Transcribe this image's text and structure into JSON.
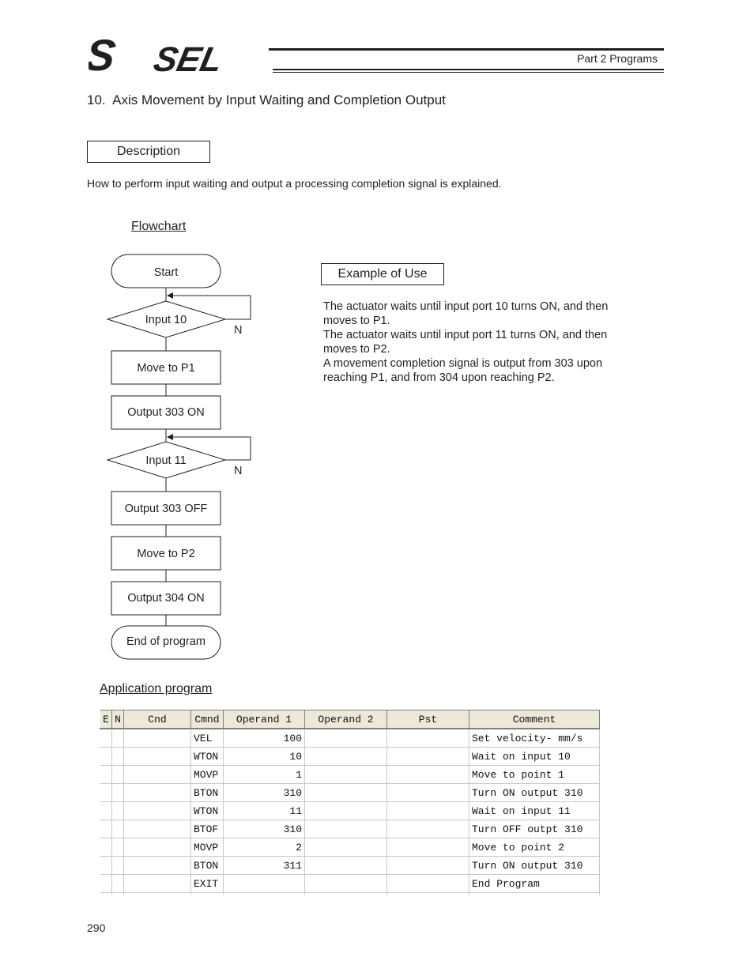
{
  "header": {
    "logo_text": "S SEL",
    "part_label": "Part 2 Programs"
  },
  "section_title": "10.  Axis Movement by Input Waiting and Completion Output",
  "description": {
    "box_label": "Description",
    "text": "How to perform input waiting and output a processing completion signal is explained."
  },
  "flowchart": {
    "label": "Flowchart",
    "nodes": {
      "start": "Start",
      "input10": "Input 10",
      "move_p1": "Move to P1",
      "out303_on": "Output 303 ON",
      "input11": "Input 11",
      "out303_off": "Output 303 OFF",
      "move_p2": "Move to P2",
      "out304_on": "Output 304 ON",
      "end": "End of program"
    },
    "no_branch_label": "N"
  },
  "example": {
    "box_label": "Example of Use",
    "lines": [
      "The actuator waits until input port 10 turns ON, and then",
      "moves to P1.",
      "The actuator waits until input port 11 turns ON, and then",
      "moves to P2.",
      "A movement completion signal is output from 303 upon",
      "reaching P1, and from 304 upon reaching P2."
    ]
  },
  "application_program": {
    "label": "Application program",
    "columns": [
      "E",
      "N",
      "Cnd",
      "Cmnd",
      "Operand 1",
      "Operand 2",
      "Pst",
      "Comment"
    ],
    "rows": [
      {
        "e": "",
        "n": "",
        "cnd": "",
        "cmnd": "VEL",
        "op1": "100",
        "op2": "",
        "pst": "",
        "comment": "Set velocity- mm/s"
      },
      {
        "e": "",
        "n": "",
        "cnd": "",
        "cmnd": "WTON",
        "op1": "10",
        "op2": "",
        "pst": "",
        "comment": "Wait on input 10"
      },
      {
        "e": "",
        "n": "",
        "cnd": "",
        "cmnd": "MOVP",
        "op1": "1",
        "op2": "",
        "pst": "",
        "comment": "Move to point 1"
      },
      {
        "e": "",
        "n": "",
        "cnd": "",
        "cmnd": "BTON",
        "op1": "310",
        "op2": "",
        "pst": "",
        "comment": "Turn ON output 310"
      },
      {
        "e": "",
        "n": "",
        "cnd": "",
        "cmnd": "WTON",
        "op1": "11",
        "op2": "",
        "pst": "",
        "comment": "Wait on input 11"
      },
      {
        "e": "",
        "n": "",
        "cnd": "",
        "cmnd": "BTOF",
        "op1": "310",
        "op2": "",
        "pst": "",
        "comment": "Turn OFF outpt 310"
      },
      {
        "e": "",
        "n": "",
        "cnd": "",
        "cmnd": "MOVP",
        "op1": "2",
        "op2": "",
        "pst": "",
        "comment": "Move to point 2"
      },
      {
        "e": "",
        "n": "",
        "cnd": "",
        "cmnd": "BTON",
        "op1": "311",
        "op2": "",
        "pst": "",
        "comment": "Turn ON output 310"
      },
      {
        "e": "",
        "n": "",
        "cnd": "",
        "cmnd": "EXIT",
        "op1": "",
        "op2": "",
        "pst": "",
        "comment": "End Program"
      }
    ]
  },
  "page_number": "290"
}
